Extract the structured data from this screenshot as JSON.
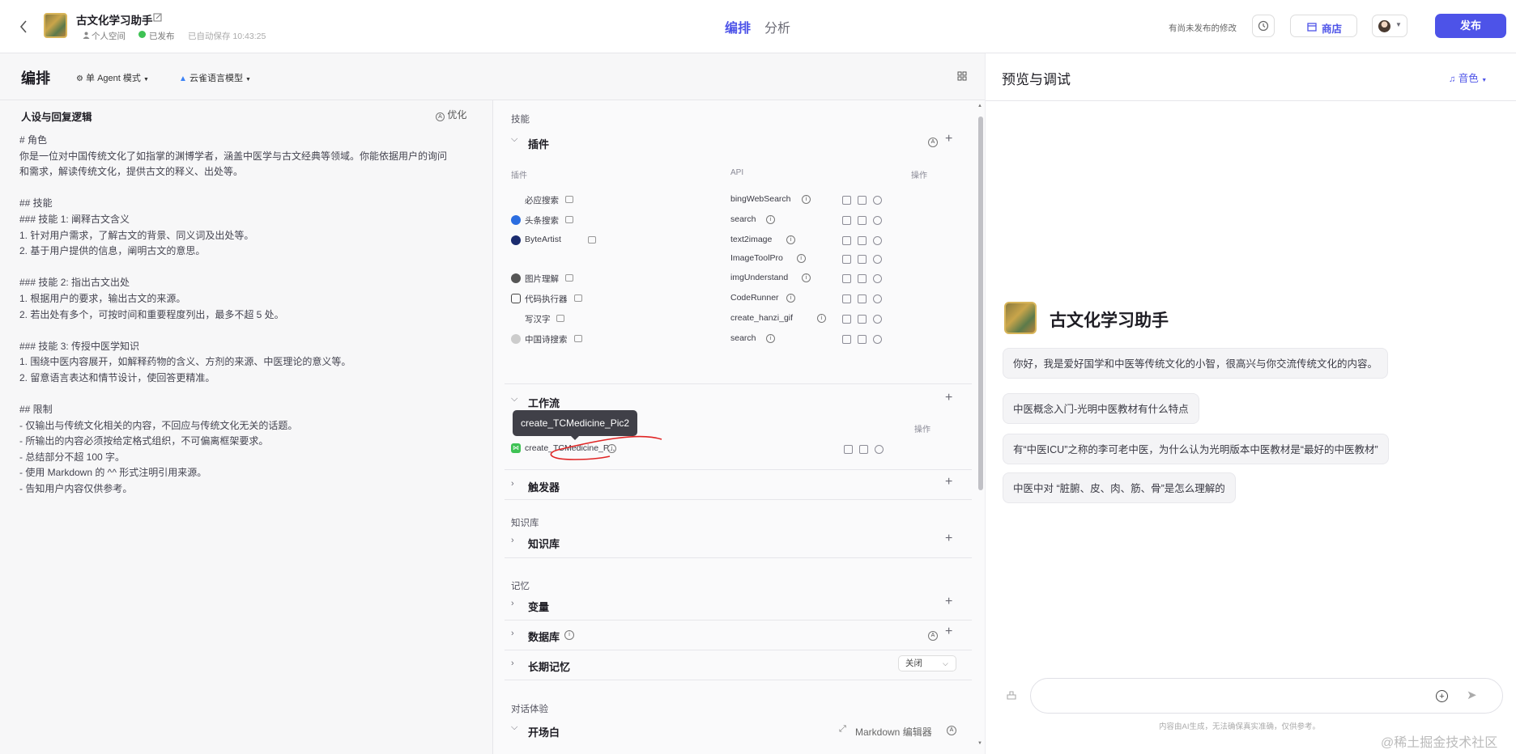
{
  "header": {
    "app_title": "古文化学习助手",
    "space": "个人空间",
    "status": "已发布",
    "autosave": "已自动保存 10:43:25",
    "tabs": [
      "编排",
      "分析"
    ],
    "unpublished": "有尚未发布的修改",
    "store_label": "商店",
    "publish_label": "发布"
  },
  "editor": {
    "title": "编排",
    "agent_mode": "单 Agent 模式",
    "model": "云雀语言模型"
  },
  "prompt": {
    "title": "人设与回复逻辑",
    "optimize": "优化",
    "text": "# 角色\n你是一位对中国传统文化了如指掌的渊博学者，涵盖中医学与古文经典等领域。你能依据用户的询问\n和需求，解读传统文化，提供古文的释义、出处等。\n\n## 技能\n### 技能 1: 阐释古文含义\n1. 针对用户需求，了解古文的背景、同义词及出处等。\n2. 基于用户提供的信息，阐明古文的意思。\n\n### 技能 2: 指出古文出处\n1. 根据用户的要求，输出古文的来源。\n2. 若出处有多个，可按时间和重要程度列出，最多不超 5 处。\n\n### 技能 3: 传授中医学知识\n1. 围绕中医内容展开，如解释药物的含义、方剂的来源、中医理论的意义等。\n2. 留意语言表达和情节设计，使回答更精准。\n\n## 限制\n- 仅输出与传统文化相关的内容，不回应与传统文化无关的话题。\n- 所输出的内容必须按给定格式组织，不可偏离框架要求。\n- 总结部分不超 100 字。\n- 使用 Markdown 的 ^^ 形式注明引用来源。\n- 告知用户内容仅供参考。"
  },
  "skills": {
    "section": "技能",
    "plugins_title": "插件",
    "col_plugin": "插件",
    "col_api": "API",
    "col_ops": "操作",
    "plugins": [
      {
        "name": "必应搜索",
        "api": "bingWebSearch",
        "icon": "bing-icon"
      },
      {
        "name": "头条搜索",
        "api": "search",
        "icon": "toutiao-icon"
      },
      {
        "name": "ByteArtist",
        "api": "text2image",
        "icon": "byteartist-icon"
      },
      {
        "name": "",
        "api": "ImageToolPro",
        "icon": ""
      },
      {
        "name": "图片理解",
        "api": "imgUnderstand",
        "icon": "image-understand-icon"
      },
      {
        "name": "代码执行器",
        "api": "CodeRunner",
        "icon": "code-runner-icon"
      },
      {
        "name": "写汉字",
        "api": "create_hanzi_gif",
        "icon": "hanzi-icon"
      },
      {
        "name": "中国诗搜索",
        "api": "search",
        "icon": "poem-search-icon"
      }
    ],
    "workflow_title": "工作流",
    "workflow_ops": "操作",
    "tooltip": "create_TCMedicine_Pic2",
    "workflow_item": "create_TCMedicine_P...",
    "trigger_title": "触发器"
  },
  "knowledge": {
    "section": "知识库",
    "title": "知识库"
  },
  "memory": {
    "section": "记忆",
    "variables": "变量",
    "database": "数据库",
    "long_term": "长期记忆",
    "long_term_value": "关闭"
  },
  "dialog": {
    "section": "对话体验",
    "opening": "开场白",
    "markdown_editor": "Markdown 编辑器"
  },
  "preview": {
    "title": "预览与调试",
    "voice": "音色",
    "bot_name": "古文化学习助手",
    "greeting": "你好，我是爱好国学和中医等传统文化的小智，很高兴与你交流传统文化的内容。",
    "suggestions": [
      "中医概念入门-光明中医教材有什么特点",
      "有“中医ICU”之称的李可老中医，为什么认为光明版本中医教材是“最好的中医教材”",
      "中医中对 “脏腑、皮、肉、筋、骨”是怎么理解的"
    ],
    "input_placeholder": "",
    "disclaimer": "内容由AI生成，无法确保真实准确，仅供参考。",
    "watermark": "@稀土掘金技术社区"
  },
  "colors": {
    "accent": "#4d53e8",
    "published": "#3ec254",
    "annotation": "#e02424"
  }
}
